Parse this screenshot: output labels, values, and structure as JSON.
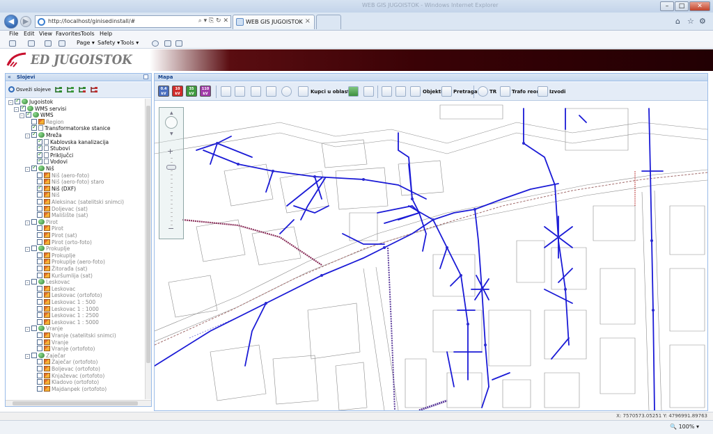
{
  "window": {
    "title": "WEB GIS JUGOISTOK - Windows Internet Explorer"
  },
  "browser": {
    "url": "http://localhost/ginisedinstall/#",
    "active_tab": "WEB GIS JUGOISTOK",
    "menu": [
      "File",
      "Edit",
      "View",
      "Favorites",
      "Tools",
      "Help"
    ],
    "commands": [
      "Page ▾",
      "Safety ▾",
      "Tools ▾"
    ],
    "zoom": "100%"
  },
  "banner": {
    "logo_text": "ED JUGOISTOK"
  },
  "layers_panel": {
    "title": "Slojevi",
    "refresh_label": "Osveži slojeve",
    "tree": [
      {
        "label": "Jugoistok",
        "level": 0,
        "exp": "-",
        "checked": true,
        "icon": "globe",
        "dim": false
      },
      {
        "label": "WMS servisi",
        "level": 1,
        "exp": "-",
        "checked": true,
        "icon": "globe",
        "dim": false
      },
      {
        "label": "WMS",
        "level": 2,
        "exp": "-",
        "checked": true,
        "icon": "globe",
        "dim": false
      },
      {
        "label": "Region",
        "level": 3,
        "exp": "",
        "checked": false,
        "icon": "layer",
        "dim": true
      },
      {
        "label": "Transformatorske stanice",
        "level": 3,
        "exp": "",
        "checked": true,
        "icon": "doc",
        "dim": false
      },
      {
        "label": "Mreža",
        "level": 3,
        "exp": "-",
        "checked": true,
        "icon": "globe",
        "dim": false
      },
      {
        "label": "Kablovska kanalizacija",
        "level": 4,
        "exp": "",
        "checked": true,
        "icon": "doc",
        "dim": false
      },
      {
        "label": "Stubovi",
        "level": 4,
        "exp": "",
        "checked": true,
        "icon": "doc",
        "dim": false
      },
      {
        "label": "Priključci",
        "level": 4,
        "exp": "",
        "checked": true,
        "icon": "doc",
        "dim": false
      },
      {
        "label": "Vodovi",
        "level": 4,
        "exp": "",
        "checked": true,
        "icon": "doc",
        "dim": false
      },
      {
        "label": "Niš",
        "level": 3,
        "exp": "-",
        "checked": true,
        "icon": "globe",
        "dim": false
      },
      {
        "label": "Niš (aero-foto)",
        "level": 4,
        "exp": "",
        "checked": false,
        "icon": "layer",
        "dim": true
      },
      {
        "label": "Niš (aero-foto) staro",
        "level": 4,
        "exp": "",
        "checked": false,
        "icon": "layer",
        "dim": true
      },
      {
        "label": "Niš (DXF)",
        "level": 4,
        "exp": "",
        "checked": true,
        "icon": "layer",
        "dim": false
      },
      {
        "label": "Niš",
        "level": 4,
        "exp": "",
        "checked": false,
        "icon": "layer",
        "dim": true
      },
      {
        "label": "Aleksinac (satelitski snimci)",
        "level": 4,
        "exp": "",
        "checked": false,
        "icon": "layer",
        "dim": true
      },
      {
        "label": "Doljevac (sat)",
        "level": 4,
        "exp": "",
        "checked": false,
        "icon": "layer",
        "dim": true
      },
      {
        "label": "Mališište (sat)",
        "level": 4,
        "exp": "",
        "checked": false,
        "icon": "layer",
        "dim": true
      },
      {
        "label": "Pirot",
        "level": 3,
        "exp": "-",
        "checked": false,
        "icon": "globe",
        "dim": true
      },
      {
        "label": "Pirot",
        "level": 4,
        "exp": "",
        "checked": false,
        "icon": "layer",
        "dim": true
      },
      {
        "label": "Pirot (sat)",
        "level": 4,
        "exp": "",
        "checked": false,
        "icon": "layer",
        "dim": true
      },
      {
        "label": "Pirot (orto-foto)",
        "level": 4,
        "exp": "",
        "checked": false,
        "icon": "layer",
        "dim": true
      },
      {
        "label": "Prokuplje",
        "level": 3,
        "exp": "-",
        "checked": false,
        "icon": "globe",
        "dim": true
      },
      {
        "label": "Prokuplje",
        "level": 4,
        "exp": "",
        "checked": false,
        "icon": "layer",
        "dim": true
      },
      {
        "label": "Prokuplje (aero-foto)",
        "level": 4,
        "exp": "",
        "checked": false,
        "icon": "layer",
        "dim": true
      },
      {
        "label": "Žitorađa (sat)",
        "level": 4,
        "exp": "",
        "checked": false,
        "icon": "layer",
        "dim": true
      },
      {
        "label": "Kuršumlija (sat)",
        "level": 4,
        "exp": "",
        "checked": false,
        "icon": "layer",
        "dim": true
      },
      {
        "label": "Leskovac",
        "level": 3,
        "exp": "-",
        "checked": false,
        "icon": "globe",
        "dim": true
      },
      {
        "label": "Leskovac",
        "level": 4,
        "exp": "",
        "checked": false,
        "icon": "layer",
        "dim": true
      },
      {
        "label": "Leskovac (ortofoto)",
        "level": 4,
        "exp": "",
        "checked": false,
        "icon": "layer",
        "dim": true
      },
      {
        "label": "Leskovac 1 : 500",
        "level": 4,
        "exp": "",
        "checked": false,
        "icon": "layer",
        "dim": true
      },
      {
        "label": "Leskovac 1 : 1000",
        "level": 4,
        "exp": "",
        "checked": false,
        "icon": "layer",
        "dim": true
      },
      {
        "label": "Leskovac 1 : 2500",
        "level": 4,
        "exp": "",
        "checked": false,
        "icon": "layer",
        "dim": true
      },
      {
        "label": "Leskovac 1 : 5000",
        "level": 4,
        "exp": "",
        "checked": false,
        "icon": "layer",
        "dim": true
      },
      {
        "label": "Vranje",
        "level": 3,
        "exp": "-",
        "checked": false,
        "icon": "globe",
        "dim": true
      },
      {
        "label": "Vranje (satelitski snimci)",
        "level": 4,
        "exp": "",
        "checked": false,
        "icon": "layer",
        "dim": true
      },
      {
        "label": "Vranje",
        "level": 4,
        "exp": "",
        "checked": false,
        "icon": "layer",
        "dim": true
      },
      {
        "label": "Vranje (ortofoto)",
        "level": 4,
        "exp": "",
        "checked": false,
        "icon": "layer",
        "dim": true
      },
      {
        "label": "Zaječar",
        "level": 3,
        "exp": "-",
        "checked": false,
        "icon": "globe",
        "dim": true
      },
      {
        "label": "Zaječar (ortofoto)",
        "level": 4,
        "exp": "",
        "checked": false,
        "icon": "layer",
        "dim": true
      },
      {
        "label": "Boljevac (ortofoto)",
        "level": 4,
        "exp": "",
        "checked": false,
        "icon": "layer",
        "dim": true
      },
      {
        "label": "Knjaževac (ortofoto)",
        "level": 4,
        "exp": "",
        "checked": false,
        "icon": "layer",
        "dim": true
      },
      {
        "label": "Kladovo (ortofoto)",
        "level": 4,
        "exp": "",
        "checked": false,
        "icon": "layer",
        "dim": true
      },
      {
        "label": "Majdanpek (ortofoto)",
        "level": 4,
        "exp": "",
        "checked": false,
        "icon": "layer",
        "dim": true
      }
    ]
  },
  "map_panel": {
    "title": "Mapa",
    "kv_buttons": [
      {
        "label": "0.4 kV",
        "color": "#4a6fbf"
      },
      {
        "label": "10 kV",
        "color": "#d02a2a"
      },
      {
        "label": "35 kV",
        "color": "#3e9a3e"
      },
      {
        "label": "110 kV",
        "color": "#a03aa8"
      }
    ],
    "tools": {
      "kupci_label": "Kupci u oblasti",
      "objekti_label": "Objekti",
      "pretraga_label": "Pretraga",
      "tr_label": "TR",
      "trafo_label": "Trafo reoni",
      "izvodi_label": "Izvodi"
    },
    "coordinates": "X: 7570573.05251 Y: 4796991.89763"
  },
  "colors": {
    "network_line": "#1a1ad6",
    "parcel_line": "#8a8a8a",
    "panel_border": "#99bbe8",
    "banner_dark": "#3a0206"
  }
}
